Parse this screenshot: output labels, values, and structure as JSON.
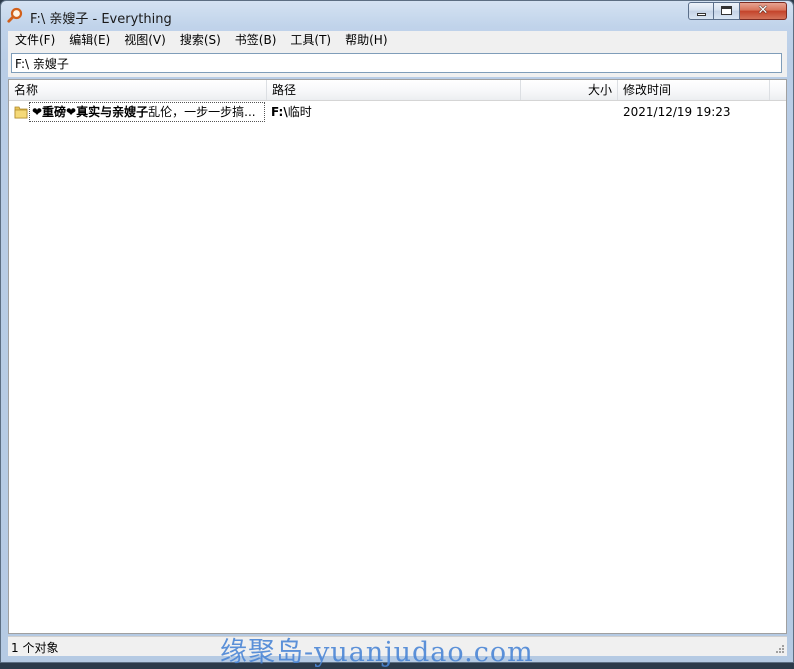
{
  "window": {
    "title": "F:\\ 亲嫂子 - Everything",
    "controls": {
      "minimize": "minimize-icon",
      "maximize": "maximize-icon",
      "close": "close-icon"
    }
  },
  "menu": {
    "items": [
      {
        "label": "文件(F)"
      },
      {
        "label": "编辑(E)"
      },
      {
        "label": "视图(V)"
      },
      {
        "label": "搜索(S)"
      },
      {
        "label": "书签(B)"
      },
      {
        "label": "工具(T)"
      },
      {
        "label": "帮助(H)"
      }
    ]
  },
  "search": {
    "value": "F:\\ 亲嫂子"
  },
  "list": {
    "columns": {
      "name": "名称",
      "path": "路径",
      "size": "大小",
      "modified": "修改时间"
    },
    "rows": [
      {
        "icon": "folder-icon",
        "name_parts": [
          "❤重磅❤真实与",
          "亲嫂子",
          "乱伦，一步一步搞..."
        ],
        "path_bold": "F:\\",
        "path_rest": "临时",
        "size": "",
        "modified": "2021/12/19 19:23"
      }
    ]
  },
  "status": {
    "text": "1 个对象"
  },
  "watermark": {
    "text": "缘聚岛-yuanjudao.com"
  },
  "colors": {
    "accent": "#4b86d6",
    "selection_border": "#555555",
    "window_frame": "#b9cde6"
  }
}
